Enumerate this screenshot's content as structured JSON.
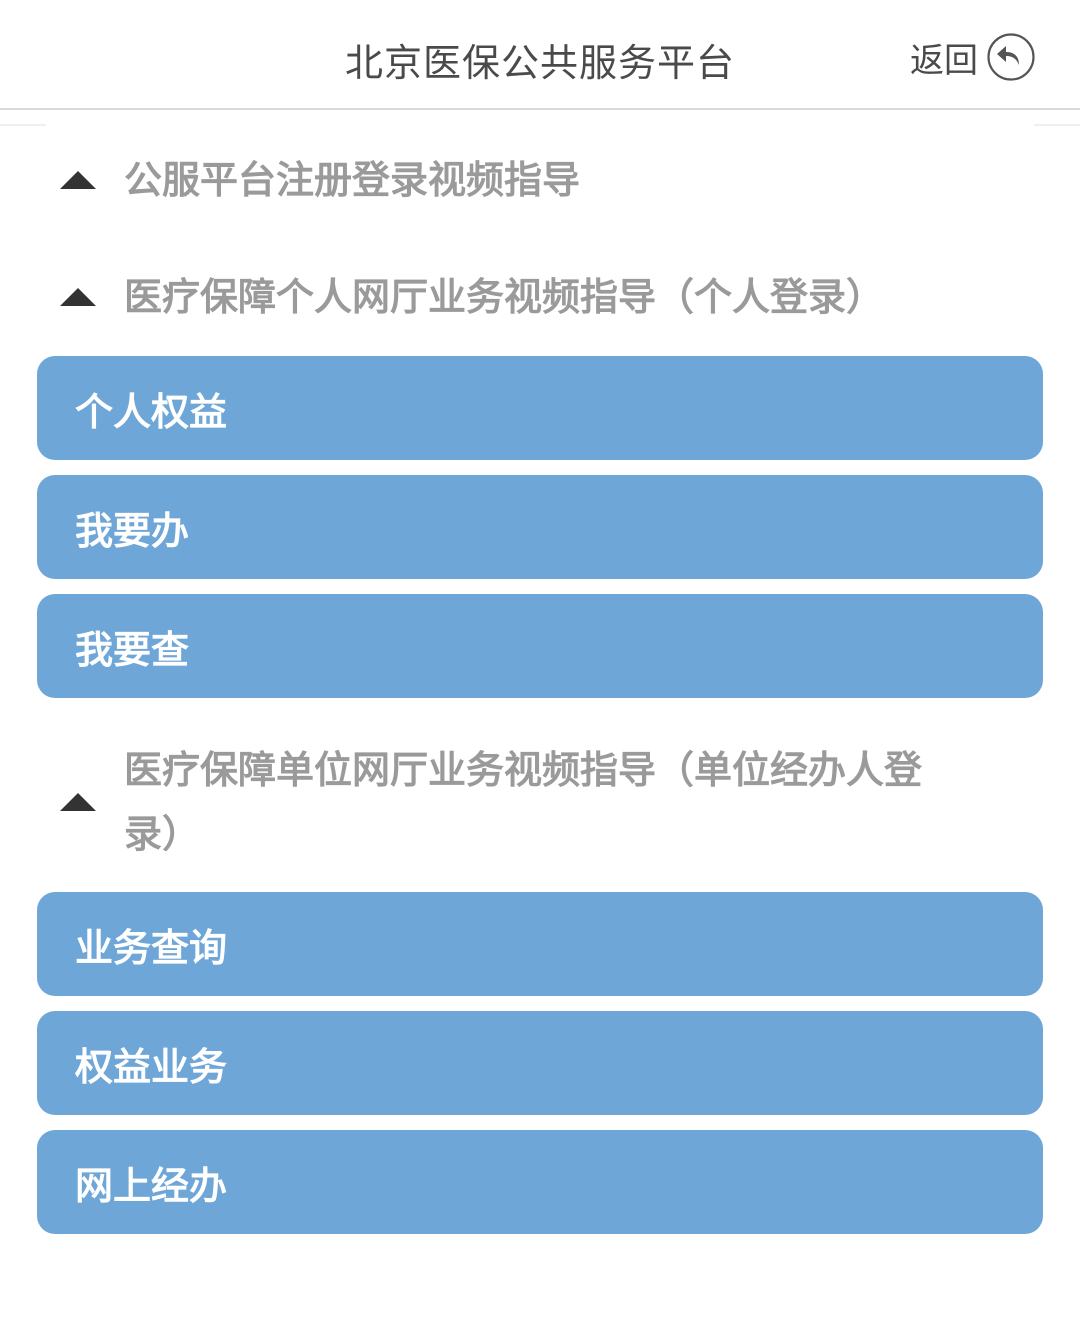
{
  "header": {
    "title": "北京医保公共服务平台",
    "back_label": "返回"
  },
  "sections": [
    {
      "title": "公服平台注册登录视频指导",
      "items": []
    },
    {
      "title": "医疗保障个人网厅业务视频指导（个人登录）",
      "items": [
        {
          "label": "个人权益"
        },
        {
          "label": "我要办"
        },
        {
          "label": "我要查"
        }
      ]
    },
    {
      "title": "医疗保障单位网厅业务视频指导（单位经办人登录）",
      "items": [
        {
          "label": "业务查询"
        },
        {
          "label": "权益业务"
        },
        {
          "label": "网上经办"
        }
      ]
    }
  ],
  "icons": {
    "back": "back-arrow-icon",
    "section_toggle": "triangle-up-icon"
  },
  "colors": {
    "button_bg": "#6ea6d8",
    "button_text": "#ffffff",
    "section_title": "#9a9a9a",
    "header_text": "#4a4a4a"
  }
}
